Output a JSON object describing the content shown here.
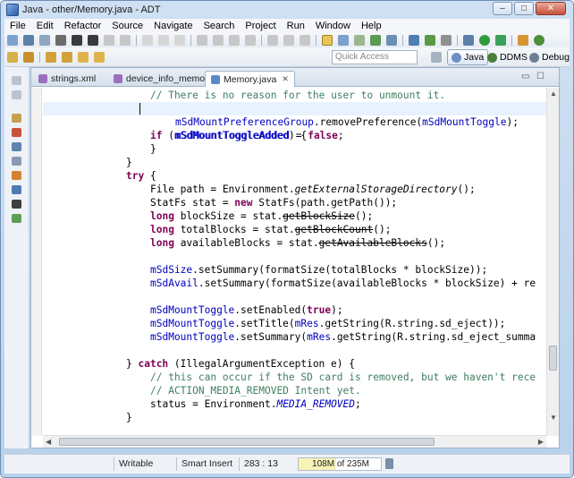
{
  "window": {
    "title": "Java - other/Memory.java - ADT",
    "controls": {
      "minimize": "–",
      "maximize": "□",
      "close": "✕"
    }
  },
  "menu": [
    "File",
    "Edit",
    "Refactor",
    "Source",
    "Navigate",
    "Search",
    "Project",
    "Run",
    "Window",
    "Help"
  ],
  "toolbar": {
    "quick_access_placeholder": "Quick Access",
    "perspectives": {
      "java": "Java",
      "ddms": "DDMS",
      "debug": "Debug"
    }
  },
  "editor": {
    "tabs": [
      {
        "label": "strings.xml",
        "active": false
      },
      {
        "label": "device_info_memory.xml",
        "active": false
      },
      {
        "label": "Memory.java",
        "active": true,
        "close": "✕"
      }
    ],
    "tab_controls": {
      "minimize": "▭",
      "maximize": "☐"
    },
    "code": {
      "l1": "// There is no reason for the user to unmount it.",
      "l2_kw": "if",
      "l2_a": " (",
      "l2_f": "mSdMountToggleAdded",
      "l2_b": ") {",
      "l3_f1": "mSdMountPreferenceGroup",
      "l3_a": ".removePreference(",
      "l3_f2": "mSdMountToggle",
      "l3_b": ");",
      "l4_f": "mSdMountToggleAdded",
      "l4_a": " = ",
      "l4_kw": "false",
      "l4_b": ";",
      "l5": "}",
      "l6": "}",
      "l7_kw": "try",
      "l7_a": " {",
      "l8_a": "File path = Environment.",
      "l8_i": "getExternalStorageDirectory",
      "l8_b": "();",
      "l9_a": "StatFs stat = ",
      "l9_kw": "new",
      "l9_b": " StatFs(path.getPath());",
      "l10_kw": "long",
      "l10_a": " blockSize = stat.",
      "l10_s": "getBlockSize",
      "l10_b": "();",
      "l11_kw": "long",
      "l11_a": " totalBlocks = stat.",
      "l11_s": "getBlockCount",
      "l11_b": "();",
      "l12_kw": "long",
      "l12_a": " availableBlocks = stat.",
      "l12_s": "getAvailableBlocks",
      "l12_b": "();",
      "l14_f": "mSdSize",
      "l14_a": ".setSummary(formatSize(totalBlocks * blockSize));",
      "l15_f": "mSdAvail",
      "l15_a": ".setSummary(formatSize(availableBlocks * blockSize) + re",
      "l17_f": "mSdMountToggle",
      "l17_a": ".setEnabled(",
      "l17_kw": "true",
      "l17_b": ");",
      "l18_f1": "mSdMountToggle",
      "l18_a": ".setTitle(",
      "l18_f2": "mRes",
      "l18_b": ".getString(R.string.sd_eject));",
      "l19_f1": "mSdMountToggle",
      "l19_a": ".setSummary(",
      "l19_f2": "mRes",
      "l19_b": ".getString(R.string.sd_eject_summa",
      "l21_a": "} ",
      "l21_kw": "catch",
      "l21_b": " (IllegalArgumentException e) {",
      "l22": "// this can occur if the SD card is removed, but we haven't rece",
      "l23": "// ACTION_MEDIA_REMOVED Intent yet.",
      "l24_a": "status = Environment.",
      "l24_c": "MEDIA_REMOVED",
      "l24_b": ";",
      "l25": "}"
    }
  },
  "status": {
    "mode": "Writable",
    "insert": "Smart Insert",
    "position": "283 : 13",
    "heap_used_mb": 108,
    "heap_total_mb": 235,
    "heap_text": "108M of 235M"
  },
  "colors": {
    "keyword": "#7f0055",
    "field": "#0000c0",
    "comment": "#3f7f5f",
    "current_line": "#e8f2fe"
  }
}
